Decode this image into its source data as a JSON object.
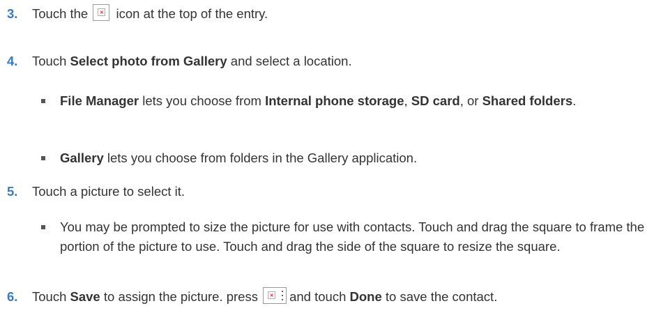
{
  "steps": [
    {
      "num": "3.",
      "before_icon": "Touch the",
      "after_icon": "icon at the top of the entry.",
      "icon": "broken-image-icon"
    },
    {
      "num": "4.",
      "t1": "Touch ",
      "b1": "Select photo from Gallery",
      "t2": " and select a location."
    },
    {
      "num": "5.",
      "text": "Touch a picture to select it."
    },
    {
      "num": "6.",
      "t1": "Touch ",
      "b1": "Save",
      "t2": " to assign the picture. press",
      "t3": "and touch ",
      "b2": "Done",
      "t4": " to save the contact.",
      "icon": "menu-icon"
    }
  ],
  "sub_items": {
    "file_manager": {
      "b1": "File Manager",
      "t1": " lets you choose from ",
      "b2": "Internal phone storage",
      "t2": ", ",
      "b3": "SD card",
      "t3": ", or ",
      "b4": "Shared folders",
      "t4": "."
    },
    "gallery": {
      "b1": "Gallery",
      "t1": " lets you choose from folders in the Gallery application."
    },
    "resize": {
      "text": "You may be prompted to size the picture for use with contacts. Touch and drag the square to frame the portion of the picture to use. Touch and drag the side of the square to resize the square."
    }
  }
}
